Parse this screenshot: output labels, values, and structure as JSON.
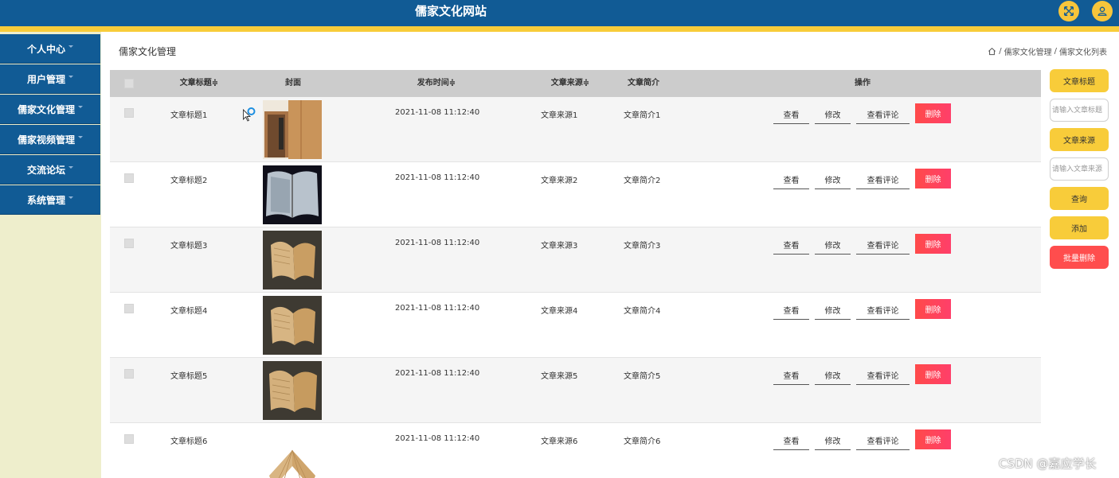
{
  "header": {
    "title": "儒家文化网站",
    "fullscreen_icon": "expand-arrows-icon",
    "user_icon": "user-icon"
  },
  "sidebar": {
    "items": [
      {
        "label": "个人中心"
      },
      {
        "label": "用户管理"
      },
      {
        "label": "儒家文化管理"
      },
      {
        "label": "儒家视频管理"
      },
      {
        "label": "交流论坛"
      },
      {
        "label": "系统管理"
      }
    ]
  },
  "page": {
    "title": "儒家文化管理",
    "breadcrumb": {
      "sep": "/",
      "level1": "儒家文化管理",
      "level2": "儒家文化列表"
    }
  },
  "table": {
    "headers": {
      "title": "文章标题",
      "cover": "封面",
      "time": "发布时间",
      "source": "文章来源",
      "summary": "文章简介",
      "actions": "操作"
    },
    "sort_icon": "≑",
    "actions": {
      "view": "查看",
      "edit": "修改",
      "comments": "查看评论",
      "delete": "删除"
    },
    "rows": [
      {
        "title": "文章标题1",
        "time": "2021-11-08 11:12:40",
        "source": "文章来源1",
        "summary": "文章简介1"
      },
      {
        "title": "文章标题2",
        "time": "2021-11-08 11:12:40",
        "source": "文章来源2",
        "summary": "文章简介2"
      },
      {
        "title": "文章标题3",
        "time": "2021-11-08 11:12:40",
        "source": "文章来源3",
        "summary": "文章简介3"
      },
      {
        "title": "文章标题4",
        "time": "2021-11-08 11:12:40",
        "source": "文章来源4",
        "summary": "文章简介4"
      },
      {
        "title": "文章标题5",
        "time": "2021-11-08 11:12:40",
        "source": "文章来源5",
        "summary": "文章简介5"
      },
      {
        "title": "文章标题6",
        "time": "2021-11-08 11:12:40",
        "source": "文章来源6",
        "summary": "文章简介6"
      }
    ]
  },
  "filters": {
    "title_label": "文章标题",
    "title_placeholder": "请输入文章标题",
    "source_label": "文章来源",
    "source_placeholder": "请输入文章来源",
    "search": "查询",
    "add": "添加",
    "batch_delete": "批量删除"
  },
  "watermark": "CSDN @嘉应学长",
  "colors": {
    "primary": "#115b95",
    "accent": "#f8cc3a",
    "danger": "#ff4a4a",
    "sidebar_bg": "#eeeecc"
  }
}
